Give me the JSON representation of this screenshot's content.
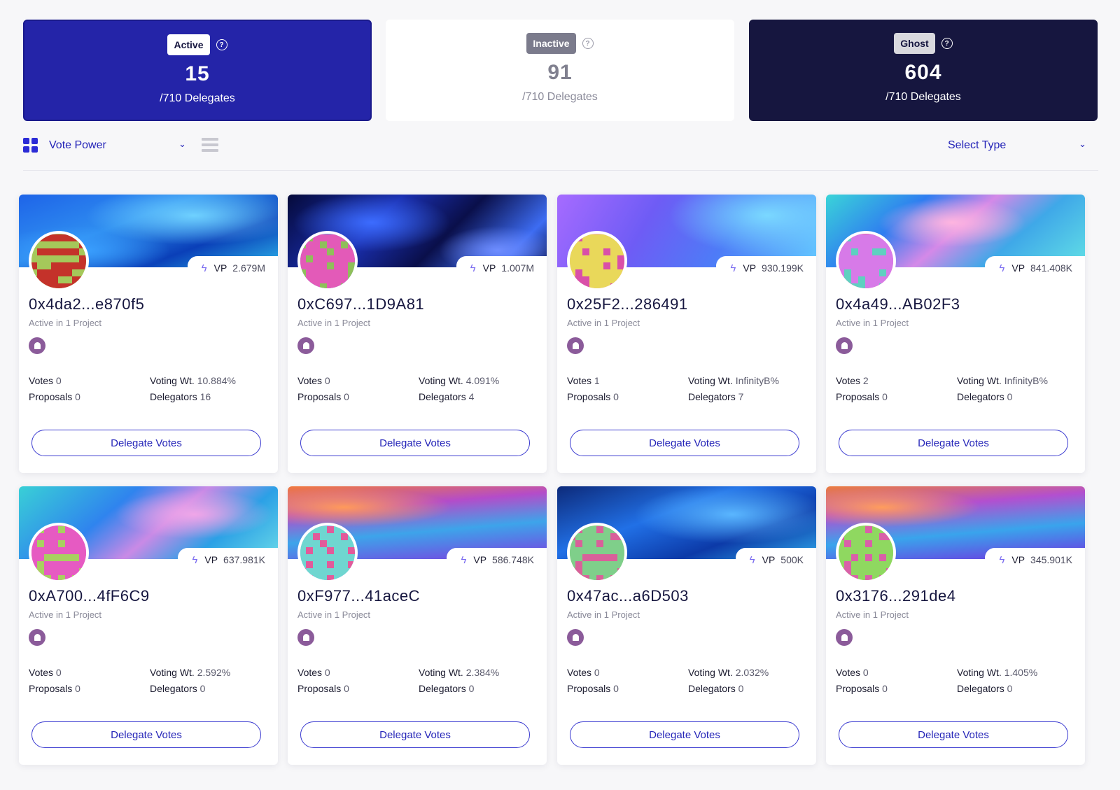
{
  "status": {
    "active": {
      "label": "Active",
      "count": "15",
      "sub": "/710 Delegates",
      "help": "?"
    },
    "inactive": {
      "label": "Inactive",
      "count": "91",
      "sub": "/710 Delegates",
      "help": "?"
    },
    "ghost": {
      "label": "Ghost",
      "count": "604",
      "sub": "/710 Delegates",
      "help": "?"
    }
  },
  "toolbar": {
    "sort_value": "Vote Power",
    "type_placeholder": "Select Type",
    "chevron": "⌄"
  },
  "colors": {
    "accent": "#2424b8",
    "active_bg": "#2424a8",
    "ghost_bg": "#16163f"
  },
  "labels": {
    "vp": "VP",
    "votes": "Votes",
    "proposals": "Proposals",
    "voting_wt": "Voting Wt.",
    "delegators": "Delegators",
    "delegate_button": "Delegate Votes",
    "bolt": "ϟ"
  },
  "delegates": [
    {
      "address": "0x4da2...e870f5",
      "vp": "2.679M",
      "projects": "Active in 1 Project",
      "votes": "0",
      "proposals": "0",
      "voting_wt": "10.884%",
      "delegators": "16"
    },
    {
      "address": "0xC697...1D9A81",
      "vp": "1.007M",
      "projects": "Active in 1 Project",
      "votes": "0",
      "proposals": "0",
      "voting_wt": "4.091%",
      "delegators": "4"
    },
    {
      "address": "0x25F2...286491",
      "vp": "930.199K",
      "projects": "Active in 1 Project",
      "votes": "1",
      "proposals": "0",
      "voting_wt": "InfinityB%",
      "delegators": "7"
    },
    {
      "address": "0x4a49...AB02F3",
      "vp": "841.408K",
      "projects": "Active in 1 Project",
      "votes": "2",
      "proposals": "0",
      "voting_wt": "InfinityB%",
      "delegators": "0"
    },
    {
      "address": "0xA700...4fF6C9",
      "vp": "637.981K",
      "projects": "Active in 1 Project",
      "votes": "0",
      "proposals": "0",
      "voting_wt": "2.592%",
      "delegators": "0"
    },
    {
      "address": "0xF977...41aceC",
      "vp": "586.748K",
      "projects": "Active in 1 Project",
      "votes": "0",
      "proposals": "0",
      "voting_wt": "2.384%",
      "delegators": "0"
    },
    {
      "address": "0x47ac...a6D503",
      "vp": "500K",
      "projects": "Active in 1 Project",
      "votes": "0",
      "proposals": "0",
      "voting_wt": "2.032%",
      "delegators": "0"
    },
    {
      "address": "0x3176...291de4",
      "vp": "345.901K",
      "projects": "Active in 1 Project",
      "votes": "0",
      "proposals": "0",
      "voting_wt": "1.405%",
      "delegators": "0"
    }
  ]
}
